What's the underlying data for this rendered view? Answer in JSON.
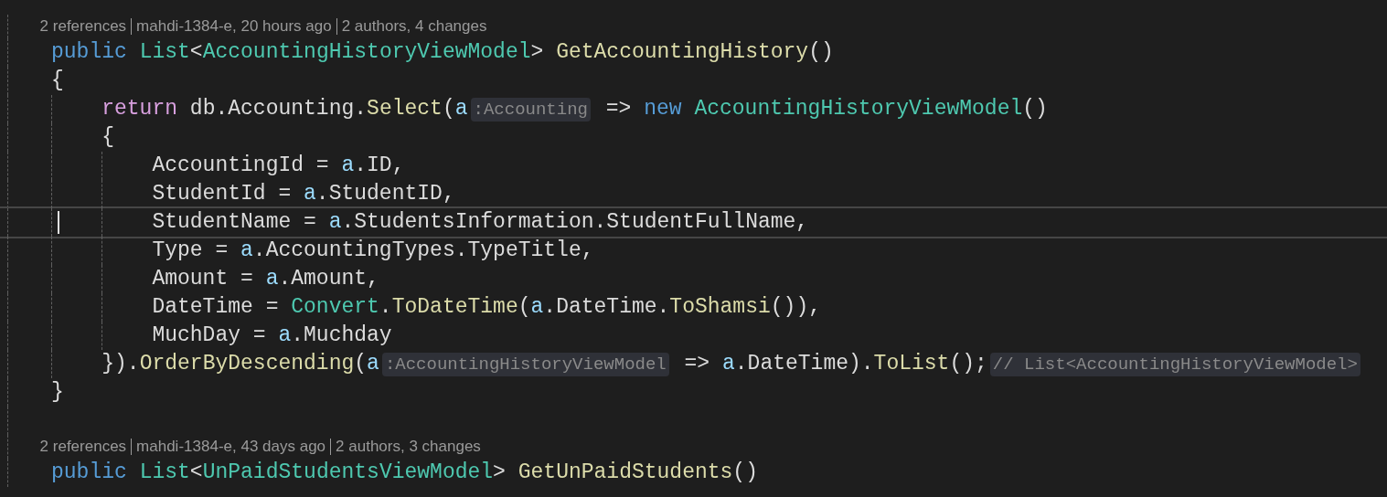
{
  "rows": [
    {
      "kind": "lens",
      "parts": [
        "2 references",
        "mahdi-1384-e, 20 hours ago",
        "2 authors, 4 changes"
      ]
    },
    {
      "kind": "code",
      "current": false,
      "tokens": [
        {
          "kind": "keyword",
          "text": "public"
        },
        {
          "kind": "type",
          "text": " List"
        },
        {
          "kind": "plain",
          "text": "<"
        },
        {
          "kind": "type",
          "text": "AccountingHistoryViewModel"
        },
        {
          "kind": "plain",
          "text": "> "
        },
        {
          "kind": "method",
          "text": "GetAccountingHistory"
        },
        {
          "kind": "plain",
          "text": "()"
        }
      ]
    },
    {
      "kind": "code",
      "current": false,
      "tokens": [
        {
          "kind": "plain",
          "text": "{"
        }
      ]
    },
    {
      "kind": "code",
      "current": false,
      "tokens": [
        {
          "kind": "control",
          "text": "    return"
        },
        {
          "kind": "plain",
          "text": " db.Accounting."
        },
        {
          "kind": "method",
          "text": "Select"
        },
        {
          "kind": "plain",
          "text": "("
        },
        {
          "kind": "param",
          "text": "a"
        },
        {
          "kind": "hint",
          "text": ":Accounting"
        },
        {
          "kind": "plain",
          "text": " => "
        },
        {
          "kind": "keyword",
          "text": "new"
        },
        {
          "kind": "type",
          "text": " AccountingHistoryViewModel"
        },
        {
          "kind": "plain",
          "text": "()"
        }
      ]
    },
    {
      "kind": "code",
      "current": false,
      "tokens": [
        {
          "kind": "plain",
          "text": "    {"
        }
      ]
    },
    {
      "kind": "code",
      "current": false,
      "tokens": [
        {
          "kind": "plain",
          "text": "        AccountingId = "
        },
        {
          "kind": "param",
          "text": "a"
        },
        {
          "kind": "plain",
          "text": ".ID,"
        }
      ]
    },
    {
      "kind": "code",
      "current": false,
      "tokens": [
        {
          "kind": "plain",
          "text": "        StudentId = "
        },
        {
          "kind": "param",
          "text": "a"
        },
        {
          "kind": "plain",
          "text": ".StudentID,"
        }
      ]
    },
    {
      "kind": "code",
      "current": true,
      "tokens": [
        {
          "kind": "plain",
          "text": "        StudentName = "
        },
        {
          "kind": "param",
          "text": "a"
        },
        {
          "kind": "plain",
          "text": ".StudentsInformation.StudentFullName,"
        }
      ]
    },
    {
      "kind": "code",
      "current": false,
      "tokens": [
        {
          "kind": "plain",
          "text": "        Type = "
        },
        {
          "kind": "param",
          "text": "a"
        },
        {
          "kind": "plain",
          "text": ".AccountingTypes.TypeTitle,"
        }
      ]
    },
    {
      "kind": "code",
      "current": false,
      "tokens": [
        {
          "kind": "plain",
          "text": "        Amount = "
        },
        {
          "kind": "param",
          "text": "a"
        },
        {
          "kind": "plain",
          "text": ".Amount,"
        }
      ]
    },
    {
      "kind": "code",
      "current": false,
      "tokens": [
        {
          "kind": "plain",
          "text": "        DateTime = "
        },
        {
          "kind": "type",
          "text": "Convert"
        },
        {
          "kind": "plain",
          "text": "."
        },
        {
          "kind": "method",
          "text": "ToDateTime"
        },
        {
          "kind": "plain",
          "text": "("
        },
        {
          "kind": "param",
          "text": "a"
        },
        {
          "kind": "plain",
          "text": ".DateTime."
        },
        {
          "kind": "method",
          "text": "ToShamsi"
        },
        {
          "kind": "plain",
          "text": "()),"
        }
      ]
    },
    {
      "kind": "code",
      "current": false,
      "tokens": [
        {
          "kind": "plain",
          "text": "        MuchDay = "
        },
        {
          "kind": "param",
          "text": "a"
        },
        {
          "kind": "plain",
          "text": ".Muchday"
        }
      ]
    },
    {
      "kind": "code",
      "current": false,
      "tokens": [
        {
          "kind": "plain",
          "text": "    })."
        },
        {
          "kind": "method",
          "text": "OrderByDescending"
        },
        {
          "kind": "plain",
          "text": "("
        },
        {
          "kind": "param",
          "text": "a"
        },
        {
          "kind": "hint",
          "text": ":AccountingHistoryViewModel"
        },
        {
          "kind": "plain",
          "text": " => "
        },
        {
          "kind": "param",
          "text": "a"
        },
        {
          "kind": "plain",
          "text": ".DateTime)."
        },
        {
          "kind": "method",
          "text": "ToList"
        },
        {
          "kind": "plain",
          "text": "();"
        },
        {
          "kind": "hint",
          "text": "// List<AccountingHistoryViewModel>"
        }
      ]
    },
    {
      "kind": "code",
      "current": false,
      "tokens": [
        {
          "kind": "plain",
          "text": "}"
        }
      ]
    },
    {
      "kind": "blank"
    },
    {
      "kind": "lens",
      "parts": [
        "2 references",
        "mahdi-1384-e, 43 days ago",
        "2 authors, 3 changes"
      ]
    },
    {
      "kind": "code",
      "current": false,
      "tokens": [
        {
          "kind": "keyword",
          "text": "public"
        },
        {
          "kind": "type",
          "text": " List"
        },
        {
          "kind": "plain",
          "text": "<"
        },
        {
          "kind": "type",
          "text": "UnPaidStudentsViewModel"
        },
        {
          "kind": "plain",
          "text": "> "
        },
        {
          "kind": "method",
          "text": "GetUnPaidStudents"
        },
        {
          "kind": "plain",
          "text": "()"
        }
      ]
    }
  ]
}
